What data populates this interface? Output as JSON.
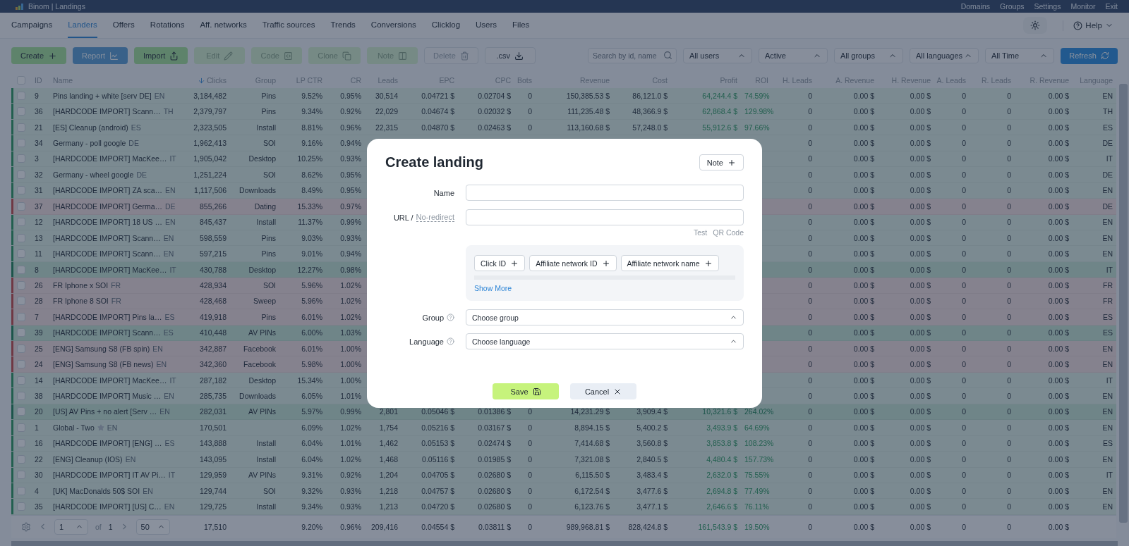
{
  "header": {
    "title": "Binom | Landings",
    "nav": [
      "Domains",
      "Groups",
      "Settings",
      "Monitor",
      "Exit"
    ]
  },
  "tabs": [
    {
      "label": "Campaigns",
      "selected": false
    },
    {
      "label": "Landers",
      "selected": true
    },
    {
      "label": "Offers",
      "selected": false
    },
    {
      "label": "Rotations",
      "selected": false
    },
    {
      "label": "Aff. networks",
      "selected": false
    },
    {
      "label": "Traffic sources",
      "selected": false
    },
    {
      "label": "Trends",
      "selected": false
    },
    {
      "label": "Conversions",
      "selected": false
    },
    {
      "label": "Clicklog",
      "selected": false
    },
    {
      "label": "Users",
      "selected": false
    },
    {
      "label": "Files",
      "selected": false
    }
  ],
  "help": {
    "label": "Help"
  },
  "toolbar": {
    "buttons": [
      {
        "label": "Create",
        "kind": "success",
        "disabled": false
      },
      {
        "label": "Report",
        "kind": "info",
        "disabled": true
      },
      {
        "label": "Import",
        "kind": "success",
        "disabled": false
      },
      {
        "label": "Edit",
        "kind": "success",
        "disabled": true
      },
      {
        "label": "Code",
        "kind": "success",
        "disabled": true
      },
      {
        "label": "Clone",
        "kind": "success",
        "disabled": true
      },
      {
        "label": "Note",
        "kind": "success",
        "disabled": true
      },
      {
        "label": "Delete",
        "kind": "plain",
        "disabled": true
      },
      {
        "label": ".csv",
        "kind": "plain",
        "disabled": false
      }
    ],
    "search": {
      "placeholder": "Search by id, name"
    },
    "filters": [
      "All users",
      "Active",
      "All groups",
      "All languages",
      "All Time"
    ],
    "refresh": "Refresh"
  },
  "table": {
    "select_all": {
      "checked": false
    },
    "columns": [
      {
        "label": "ID",
        "sorted": false
      },
      {
        "label": "Name",
        "sorted": false
      },
      {
        "label": "Clicks",
        "sorted": true
      },
      {
        "label": "Group",
        "sorted": false
      },
      {
        "label": "LP CTR",
        "sorted": false
      },
      {
        "label": "CR",
        "sorted": false
      },
      {
        "label": "Leads",
        "sorted": false
      },
      {
        "label": "EPC",
        "sorted": false
      },
      {
        "label": "CPC",
        "sorted": false
      },
      {
        "label": "Bots",
        "sorted": false
      },
      {
        "label": "Revenue",
        "sorted": false
      },
      {
        "label": "Cost",
        "sorted": false
      },
      {
        "label": "Profit",
        "sorted": false
      },
      {
        "label": "ROI",
        "sorted": false
      },
      {
        "label": "H. Leads",
        "sorted": false
      },
      {
        "label": "A. Revenue",
        "sorted": false
      },
      {
        "label": "H. Revenue",
        "sorted": false
      },
      {
        "label": "A. Leads",
        "sorted": false
      },
      {
        "label": "R. Leads",
        "sorted": false
      },
      {
        "label": "R. Revenue",
        "sorted": false
      },
      {
        "label": "Language",
        "sorted": false
      }
    ],
    "rows": [
      {
        "kind": "positive",
        "starred": false,
        "checked": false,
        "id": "9",
        "name": "Pins landing + white [serv DE]",
        "lang": "EN",
        "clicks": "3,184,482",
        "group": "Pins",
        "lp_ctr": "9.52%",
        "cr": "0.95%",
        "leads": "30,514",
        "epc": "0.04721 $",
        "cpc": "0.02704 $",
        "bots": "0",
        "revenue": "150,385.53 $",
        "cost": "86,121.0 $",
        "profit": "64,244.4 $",
        "roi": "74.59%",
        "h_leads": "0",
        "a_revenue": "0.00 $",
        "h_revenue": "0.00 $",
        "a_leads": "0",
        "r_leads": "0",
        "r_revenue": "0.00 $",
        "language": "EN"
      },
      {
        "kind": "positive",
        "starred": false,
        "checked": false,
        "id": "36",
        "name": "[HARDCODE IMPORT] Scann…",
        "lang": "TH",
        "clicks": "2,379,797",
        "group": "Pins",
        "lp_ctr": "9.34%",
        "cr": "0.92%",
        "leads": "22,029",
        "epc": "0.04674 $",
        "cpc": "0.02032 $",
        "bots": "0",
        "revenue": "111,235.48 $",
        "cost": "48,366.9 $",
        "profit": "62,868.4 $",
        "roi": "129.98%",
        "h_leads": "0",
        "a_revenue": "0.00 $",
        "h_revenue": "0.00 $",
        "a_leads": "0",
        "r_leads": "0",
        "r_revenue": "0.00 $",
        "language": "TH"
      },
      {
        "kind": "positive",
        "starred": false,
        "checked": false,
        "id": "21",
        "name": "[ES] Cleanup (android)",
        "lang": "ES",
        "clicks": "2,323,505",
        "group": "Install",
        "lp_ctr": "8.81%",
        "cr": "0.96%",
        "leads": "22,315",
        "epc": "0.04870 $",
        "cpc": "0.02463 $",
        "bots": "0",
        "revenue": "113,160.68 $",
        "cost": "57,248.0 $",
        "profit": "55,912.6 $",
        "roi": "97.66%",
        "h_leads": "0",
        "a_revenue": "0.00 $",
        "h_revenue": "0.00 $",
        "a_leads": "0",
        "r_leads": "0",
        "r_revenue": "0.00 $",
        "language": "ES"
      },
      {
        "kind": "positive",
        "starred": false,
        "checked": false,
        "id": "34",
        "name": "Germany - poll google",
        "lang": "DE",
        "clicks": "1,962,413",
        "group": "SOI",
        "lp_ctr": "9.16%",
        "cr": "0.94%",
        "h_leads": "0",
        "a_revenue": "0.00 $",
        "h_revenue": "0.00 $",
        "a_leads": "0",
        "r_leads": "0",
        "r_revenue": "0.00 $",
        "language": "DE"
      },
      {
        "kind": "positive",
        "starred": false,
        "checked": false,
        "id": "3",
        "name": "[HARDCODE IMPORT] MacKee…",
        "lang": "IT",
        "clicks": "1,905,042",
        "group": "Desktop",
        "lp_ctr": "10.25%",
        "cr": "0.93%",
        "h_leads": "0",
        "a_revenue": "0.00 $",
        "h_revenue": "0.00 $",
        "a_leads": "0",
        "r_leads": "0",
        "r_revenue": "0.00 $",
        "language": "IT"
      },
      {
        "kind": "positive",
        "starred": false,
        "checked": false,
        "id": "32",
        "name": "Germany - wheel google",
        "lang": "DE",
        "clicks": "1,251,224",
        "group": "SOI",
        "lp_ctr": "8.62%",
        "cr": "0.95%",
        "h_leads": "0",
        "a_revenue": "0.00 $",
        "h_revenue": "0.00 $",
        "a_leads": "0",
        "r_leads": "0",
        "r_revenue": "0.00 $",
        "language": "DE"
      },
      {
        "kind": "positive",
        "starred": false,
        "checked": false,
        "id": "31",
        "name": "[HARDCODE IMPORT] ZA sca…",
        "lang": "EN",
        "clicks": "1,117,506",
        "group": "Downloads",
        "lp_ctr": "8.49%",
        "cr": "0.95%",
        "h_leads": "0",
        "a_revenue": "0.00 $",
        "h_revenue": "0.00 $",
        "a_leads": "0",
        "r_leads": "0",
        "r_revenue": "0.00 $",
        "language": "EN"
      },
      {
        "kind": "negative",
        "starred": false,
        "checked": false,
        "id": "37",
        "name": "[HARDCODE IMPORT] Germa…",
        "lang": "DE",
        "clicks": "855,266",
        "group": "Dating",
        "lp_ctr": "15.33%",
        "cr": "0.97%",
        "h_leads": "0",
        "a_revenue": "0.00 $",
        "h_revenue": "0.00 $",
        "a_leads": "0",
        "r_leads": "0",
        "r_revenue": "0.00 $",
        "language": "DE"
      },
      {
        "kind": "positive",
        "starred": false,
        "checked": false,
        "id": "12",
        "name": "[HARDCODE IMPORT] 18 US …",
        "lang": "EN",
        "clicks": "845,437",
        "group": "Install",
        "lp_ctr": "11.37%",
        "cr": "0.99%",
        "h_leads": "0",
        "a_revenue": "0.00 $",
        "h_revenue": "0.00 $",
        "a_leads": "0",
        "r_leads": "0",
        "r_revenue": "0.00 $",
        "language": "EN"
      },
      {
        "kind": "positive",
        "starred": false,
        "checked": false,
        "id": "13",
        "name": "[HARDCODE IMPORT] Scann…",
        "lang": "EN",
        "clicks": "598,559",
        "group": "Pins",
        "lp_ctr": "9.03%",
        "cr": "0.93%",
        "h_leads": "0",
        "a_revenue": "0.00 $",
        "h_revenue": "0.00 $",
        "a_leads": "0",
        "r_leads": "0",
        "r_revenue": "0.00 $",
        "language": "EN"
      },
      {
        "kind": "positive",
        "starred": false,
        "checked": false,
        "id": "11",
        "name": "[HARDCODE IMPORT] Scann…",
        "lang": "EN",
        "clicks": "597,215",
        "group": "Pins",
        "lp_ctr": "9.01%",
        "cr": "0.94%",
        "h_leads": "0",
        "a_revenue": "0.00 $",
        "h_revenue": "0.00 $",
        "a_leads": "0",
        "r_leads": "0",
        "r_revenue": "0.00 $",
        "language": "EN"
      },
      {
        "kind": "strong",
        "starred": false,
        "checked": false,
        "id": "8",
        "name": "[HARDCODE IMPORT] MacKee…",
        "lang": "IT",
        "clicks": "430,788",
        "group": "Desktop",
        "lp_ctr": "12.27%",
        "cr": "0.98%",
        "h_leads": "0",
        "a_revenue": "0.00 $",
        "h_revenue": "0.00 $",
        "a_leads": "0",
        "r_leads": "0",
        "r_revenue": "0.00 $",
        "language": "IT"
      },
      {
        "kind": "negative",
        "starred": false,
        "checked": false,
        "id": "26",
        "name": "FR Iphone x SOI",
        "lang": "FR",
        "clicks": "428,934",
        "group": "SOI",
        "lp_ctr": "5.96%",
        "cr": "1.02%",
        "h_leads": "0",
        "a_revenue": "0.00 $",
        "h_revenue": "0.00 $",
        "a_leads": "0",
        "r_leads": "0",
        "r_revenue": "0.00 $",
        "language": "FR"
      },
      {
        "kind": "negative",
        "starred": false,
        "checked": false,
        "id": "28",
        "name": "FR Iphone 8 SOI",
        "lang": "FR",
        "clicks": "428,468",
        "group": "Sweep",
        "lp_ctr": "5.96%",
        "cr": "1.02%",
        "h_leads": "0",
        "a_revenue": "0.00 $",
        "h_revenue": "0.00 $",
        "a_leads": "0",
        "r_leads": "0",
        "r_revenue": "0.00 $",
        "language": "FR"
      },
      {
        "kind": "negative",
        "starred": false,
        "checked": false,
        "id": "7",
        "name": "[HARDCODE IMPORT] Pins la…",
        "lang": "ES",
        "clicks": "419,918",
        "group": "Pins",
        "lp_ctr": "6.01%",
        "cr": "1.02%",
        "h_leads": "0",
        "a_revenue": "0.00 $",
        "h_revenue": "0.00 $",
        "a_leads": "0",
        "r_leads": "0",
        "r_revenue": "0.00 $",
        "language": "ES"
      },
      {
        "kind": "strong",
        "starred": false,
        "checked": false,
        "id": "39",
        "name": "[HARDCODE IMPORT] Scann…",
        "lang": "ES",
        "clicks": "410,448",
        "group": "AV PINs",
        "lp_ctr": "6.00%",
        "cr": "1.03%",
        "h_leads": "0",
        "a_revenue": "0.00 $",
        "h_revenue": "0.00 $",
        "a_leads": "0",
        "r_leads": "0",
        "r_revenue": "0.00 $",
        "language": "ES"
      },
      {
        "kind": "negative",
        "starred": false,
        "checked": false,
        "id": "25",
        "name": "[ENG] Samsung S8 (FB spin)",
        "lang": "EN",
        "clicks": "342,887",
        "group": "Facebook",
        "lp_ctr": "6.01%",
        "cr": "1.00%",
        "h_leads": "0",
        "a_revenue": "0.00 $",
        "h_revenue": "0.00 $",
        "a_leads": "0",
        "r_leads": "0",
        "r_revenue": "0.00 $",
        "language": "EN"
      },
      {
        "kind": "negative",
        "starred": false,
        "checked": false,
        "id": "24",
        "name": "[ENG] Samsung S8 (FB news)",
        "lang": "EN",
        "clicks": "342,360",
        "group": "Facebook",
        "lp_ctr": "5.98%",
        "cr": "1.00%",
        "h_leads": "0",
        "a_revenue": "0.00 $",
        "h_revenue": "0.00 $",
        "a_leads": "0",
        "r_leads": "0",
        "r_revenue": "0.00 $",
        "language": "EN"
      },
      {
        "kind": "positive",
        "starred": false,
        "checked": false,
        "id": "14",
        "name": "[HARDCODE IMPORT] MacKee…",
        "lang": "IT",
        "clicks": "287,182",
        "group": "Desktop",
        "lp_ctr": "15.34%",
        "cr": "1.00%",
        "h_leads": "0",
        "a_revenue": "0.00 $",
        "h_revenue": "0.00 $",
        "a_leads": "0",
        "r_leads": "0",
        "r_revenue": "0.00 $",
        "language": "IT"
      },
      {
        "kind": "positive",
        "starred": false,
        "checked": false,
        "id": "38",
        "name": "[HARDCODE IMPORT] Music …",
        "lang": "EN",
        "clicks": "285,735",
        "group": "Downloads",
        "lp_ctr": "6.05%",
        "cr": "1.01%",
        "h_leads": "0",
        "a_revenue": "0.00 $",
        "h_revenue": "0.00 $",
        "a_leads": "0",
        "r_leads": "0",
        "r_revenue": "0.00 $",
        "language": "EN"
      },
      {
        "kind": "strong",
        "starred": false,
        "checked": false,
        "id": "20",
        "name": "[US] AV Pins + no alert [Serv …",
        "lang": "EN",
        "clicks": "282,031",
        "group": "AV PINs",
        "lp_ctr": "5.97%",
        "cr": "0.99%",
        "leads": "2,801",
        "epc": "0.05046 $",
        "cpc": "0.01386 $",
        "bots": "0",
        "revenue": "14,231.29 $",
        "cost": "3,909.4 $",
        "profit": "10,321.6 $",
        "roi": "264.02%",
        "h_leads": "0",
        "a_revenue": "0.00 $",
        "h_revenue": "0.00 $",
        "a_leads": "0",
        "r_leads": "0",
        "r_revenue": "0.00 $",
        "language": "EN"
      },
      {
        "kind": "positive",
        "starred": true,
        "checked": false,
        "id": "1",
        "name": "Global - Two",
        "lang": "EN",
        "clicks": "170,501",
        "lp_ctr": "6.09%",
        "cr": "1.02%",
        "leads": "1,754",
        "epc": "0.05216 $",
        "cpc": "0.03167 $",
        "bots": "0",
        "revenue": "8,894.15 $",
        "cost": "5,400.2 $",
        "profit": "3,493.9 $",
        "roi": "64.69%",
        "h_leads": "0",
        "a_revenue": "0.00 $",
        "h_revenue": "0.00 $",
        "a_leads": "0",
        "r_leads": "0",
        "r_revenue": "0.00 $",
        "language": "EN"
      },
      {
        "kind": "positive",
        "starred": false,
        "checked": false,
        "id": "16",
        "name": "[HARDCODE IMPORT] [ENG] …",
        "lang": "ES",
        "clicks": "143,888",
        "group": "Install",
        "lp_ctr": "6.04%",
        "cr": "1.01%",
        "leads": "1,462",
        "epc": "0.05153 $",
        "cpc": "0.02474 $",
        "bots": "0",
        "revenue": "7,414.68 $",
        "cost": "3,560.8 $",
        "profit": "3,853.8 $",
        "roi": "108.23%",
        "h_leads": "0",
        "a_revenue": "0.00 $",
        "h_revenue": "0.00 $",
        "a_leads": "0",
        "r_leads": "0",
        "r_revenue": "0.00 $",
        "language": "ES"
      },
      {
        "kind": "positive",
        "starred": false,
        "checked": false,
        "id": "22",
        "name": "[ENG] Cleanup (IOS)",
        "lang": "EN",
        "clicks": "143,095",
        "group": "Install",
        "lp_ctr": "6.04%",
        "cr": "1.02%",
        "leads": "1,468",
        "epc": "0.05116 $",
        "cpc": "0.01985 $",
        "bots": "0",
        "revenue": "7,321.08 $",
        "cost": "2,840.5 $",
        "profit": "4,480.4 $",
        "roi": "157.73%",
        "h_leads": "0",
        "a_revenue": "0.00 $",
        "h_revenue": "0.00 $",
        "a_leads": "0",
        "r_leads": "0",
        "r_revenue": "0.00 $",
        "language": "EN"
      },
      {
        "kind": "positive",
        "starred": false,
        "checked": false,
        "id": "30",
        "name": "[HARDCODE IMPORT] IT AV Pi…",
        "lang": "IT",
        "clicks": "129,959",
        "group": "AV PINs",
        "lp_ctr": "9.31%",
        "cr": "0.92%",
        "leads": "1,204",
        "epc": "0.04705 $",
        "cpc": "0.02680 $",
        "bots": "0",
        "revenue": "6,115.50 $",
        "cost": "3,483.4 $",
        "profit": "2,632.0 $",
        "roi": "75.55%",
        "h_leads": "0",
        "a_revenue": "0.00 $",
        "h_revenue": "0.00 $",
        "a_leads": "0",
        "r_leads": "0",
        "r_revenue": "0.00 $",
        "language": "IT"
      },
      {
        "kind": "positive",
        "starred": false,
        "checked": false,
        "id": "4",
        "name": "[UK] MacDonalds 50$ SOI",
        "lang": "EN",
        "clicks": "129,744",
        "group": "SOI",
        "lp_ctr": "9.32%",
        "cr": "0.93%",
        "leads": "1,218",
        "epc": "0.04757 $",
        "cpc": "0.02680 $",
        "bots": "0",
        "revenue": "6,172.54 $",
        "cost": "3,477.6 $",
        "profit": "2,694.8 $",
        "roi": "77.49%",
        "h_leads": "0",
        "a_revenue": "0.00 $",
        "h_revenue": "0.00 $",
        "a_leads": "0",
        "r_leads": "0",
        "r_revenue": "0.00 $",
        "language": "EN"
      },
      {
        "kind": "positive",
        "starred": false,
        "checked": false,
        "id": "35",
        "name": "[HARDCODE IMPORT] [US] C…",
        "lang": "EN",
        "clicks": "129,725",
        "group": "Install",
        "lp_ctr": "9.34%",
        "cr": "0.93%",
        "leads": "1,213",
        "epc": "0.04720 $",
        "cpc": "0.02680 $",
        "bots": "0",
        "revenue": "6,123.76 $",
        "cost": "3,477.1 $",
        "profit": "2,646.6 $",
        "roi": "76.11%",
        "h_leads": "0",
        "a_revenue": "0.00 $",
        "h_revenue": "0.00 $",
        "a_leads": "0",
        "r_leads": "0",
        "r_revenue": "0.00 $",
        "language": "EN"
      }
    ],
    "totals": {
      "clicks": "17,510",
      "lp_ctr": "9.20%",
      "cr": "0.96%",
      "leads": "209,416",
      "epc": "0.04554 $",
      "cpc": "0.03811 $",
      "bots": "0",
      "revenue": "989,968.81 $",
      "cost": "828,424.8 $",
      "profit": "161,543.9 $",
      "roi": "19.50%",
      "h_leads": "0",
      "a_revenue": "0.00 $",
      "h_revenue": "0.00 $",
      "a_leads": "0",
      "r_leads": "0",
      "r_revenue": "0.00 $"
    },
    "pagination": {
      "page": "1",
      "of": "of",
      "total": "1",
      "per_page": "50"
    }
  },
  "modal": {
    "title": "Create landing",
    "note_button": "Note",
    "name_field": {
      "label": "Name"
    },
    "url_field": {
      "label": "URL /",
      "mode_link": "No-redirect",
      "links": [
        "Test",
        "QR Code"
      ]
    },
    "tokens": [
      "Click ID",
      "Affiliate network ID",
      "Affiliate network name"
    ],
    "show_more": "Show More",
    "selects": [
      {
        "label": "Group",
        "placeholder": "Choose group"
      },
      {
        "label": "Language",
        "placeholder": "Choose language"
      }
    ],
    "save": "Save",
    "cancel": "Cancel"
  }
}
